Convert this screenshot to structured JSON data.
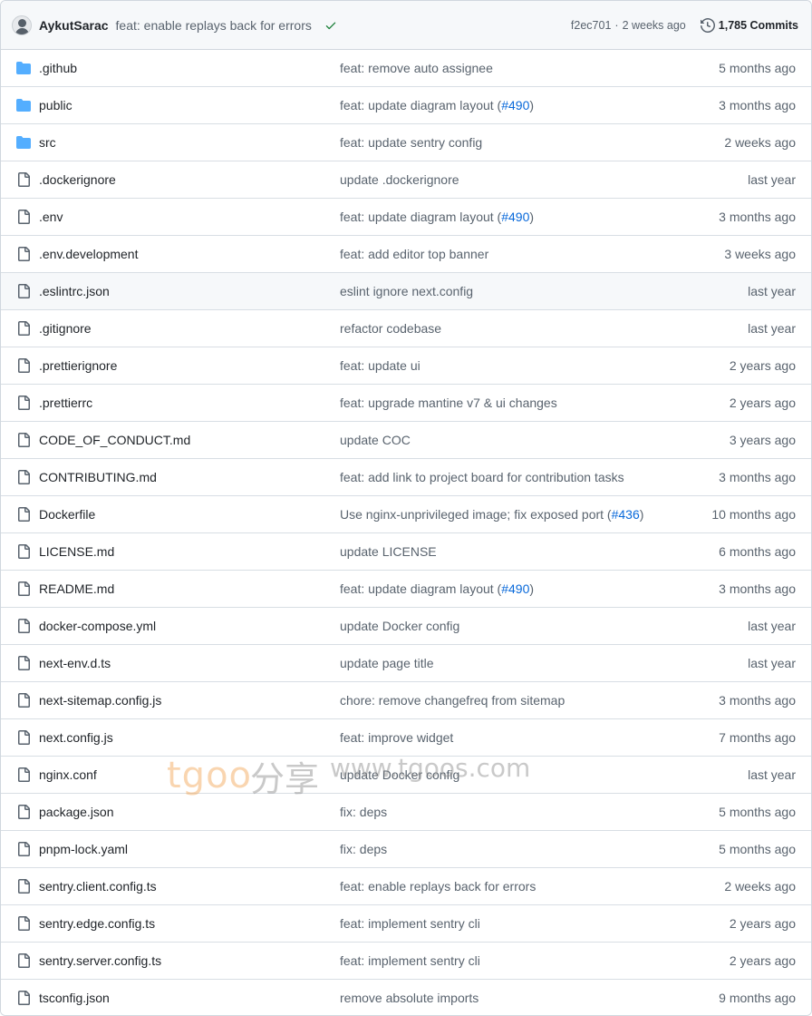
{
  "header": {
    "author": "AykutSarac",
    "message": "feat: enable replays back for errors",
    "sha": "f2ec701",
    "separator": "·",
    "age": "2 weeks ago",
    "commits": "1,785 Commits",
    "check_color": "#1a7f37"
  },
  "colors": {
    "folder": "#54aeff",
    "link": "#0969da",
    "muted": "#59636e"
  },
  "files": [
    {
      "type": "folder",
      "name": ".github",
      "message": "feat: remove auto assignee",
      "pr": "",
      "suffix": "",
      "age": "5 months ago"
    },
    {
      "type": "folder",
      "name": "public",
      "message": "feat: update diagram layout (",
      "pr": "#490",
      "suffix": ")",
      "age": "3 months ago"
    },
    {
      "type": "folder",
      "name": "src",
      "message": "feat: update sentry config",
      "pr": "",
      "suffix": "",
      "age": "2 weeks ago"
    },
    {
      "type": "file",
      "name": ".dockerignore",
      "message": "update .dockerignore",
      "pr": "",
      "suffix": "",
      "age": "last year"
    },
    {
      "type": "file",
      "name": ".env",
      "message": "feat: update diagram layout (",
      "pr": "#490",
      "suffix": ")",
      "age": "3 months ago"
    },
    {
      "type": "file",
      "name": ".env.development",
      "message": "feat: add editor top banner",
      "pr": "",
      "suffix": "",
      "age": "3 weeks ago"
    },
    {
      "type": "file",
      "name": ".eslintrc.json",
      "message": "eslint ignore next.config",
      "pr": "",
      "suffix": "",
      "age": "last year"
    },
    {
      "type": "file",
      "name": ".gitignore",
      "message": "refactor codebase",
      "pr": "",
      "suffix": "",
      "age": "last year"
    },
    {
      "type": "file",
      "name": ".prettierignore",
      "message": "feat: update ui",
      "pr": "",
      "suffix": "",
      "age": "2 years ago"
    },
    {
      "type": "file",
      "name": ".prettierrc",
      "message": "feat: upgrade mantine v7 & ui changes",
      "pr": "",
      "suffix": "",
      "age": "2 years ago"
    },
    {
      "type": "file",
      "name": "CODE_OF_CONDUCT.md",
      "message": "update COC",
      "pr": "",
      "suffix": "",
      "age": "3 years ago"
    },
    {
      "type": "file",
      "name": "CONTRIBUTING.md",
      "message": "feat: add link to project board for contribution tasks",
      "pr": "",
      "suffix": "",
      "age": "3 months ago"
    },
    {
      "type": "file",
      "name": "Dockerfile",
      "message": "Use nginx-unprivileged image; fix exposed port (",
      "pr": "#436",
      "suffix": ")",
      "age": "10 months ago"
    },
    {
      "type": "file",
      "name": "LICENSE.md",
      "message": "update LICENSE",
      "pr": "",
      "suffix": "",
      "age": "6 months ago"
    },
    {
      "type": "file",
      "name": "README.md",
      "message": "feat: update diagram layout (",
      "pr": "#490",
      "suffix": ")",
      "age": "3 months ago"
    },
    {
      "type": "file",
      "name": "docker-compose.yml",
      "message": "update Docker config",
      "pr": "",
      "suffix": "",
      "age": "last year"
    },
    {
      "type": "file",
      "name": "next-env.d.ts",
      "message": "update page title",
      "pr": "",
      "suffix": "",
      "age": "last year"
    },
    {
      "type": "file",
      "name": "next-sitemap.config.js",
      "message": "chore: remove changefreq from sitemap",
      "pr": "",
      "suffix": "",
      "age": "3 months ago"
    },
    {
      "type": "file",
      "name": "next.config.js",
      "message": "feat: improve widget",
      "pr": "",
      "suffix": "",
      "age": "7 months ago"
    },
    {
      "type": "file",
      "name": "nginx.conf",
      "message": "update Docker config",
      "pr": "",
      "suffix": "",
      "age": "last year"
    },
    {
      "type": "file",
      "name": "package.json",
      "message": "fix: deps",
      "pr": "",
      "suffix": "",
      "age": "5 months ago"
    },
    {
      "type": "file",
      "name": "pnpm-lock.yaml",
      "message": "fix: deps",
      "pr": "",
      "suffix": "",
      "age": "5 months ago"
    },
    {
      "type": "file",
      "name": "sentry.client.config.ts",
      "message": "feat: enable replays back for errors",
      "pr": "",
      "suffix": "",
      "age": "2 weeks ago"
    },
    {
      "type": "file",
      "name": "sentry.edge.config.ts",
      "message": "feat: implement sentry cli",
      "pr": "",
      "suffix": "",
      "age": "2 years ago"
    },
    {
      "type": "file",
      "name": "sentry.server.config.ts",
      "message": "feat: implement sentry cli",
      "pr": "",
      "suffix": "",
      "age": "2 years ago"
    },
    {
      "type": "file",
      "name": "tsconfig.json",
      "message": "remove absolute imports",
      "pr": "",
      "suffix": "",
      "age": "9 months ago"
    }
  ],
  "watermark": {
    "brand": "tgoo",
    "chinese": "分享",
    "url": "www.tgoos.com"
  }
}
